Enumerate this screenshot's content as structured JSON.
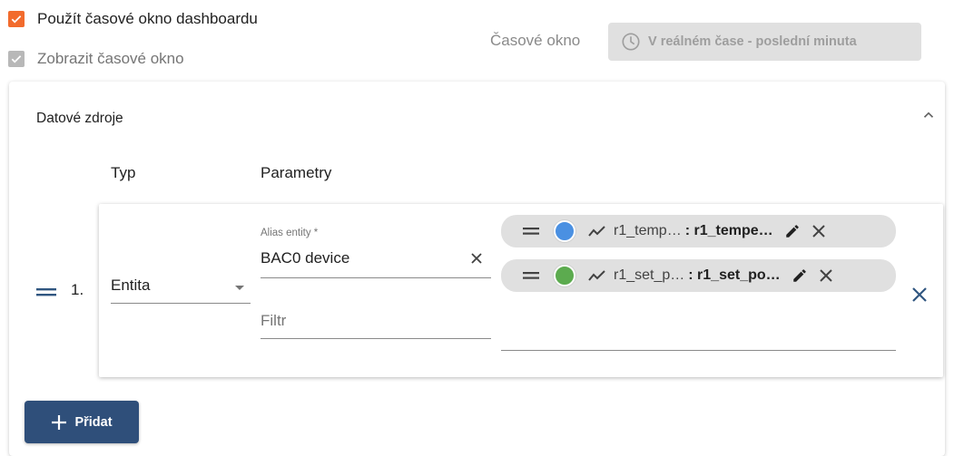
{
  "header": {
    "use_dashboard_timewindow": {
      "label": "Použít časové okno dashboardu",
      "checked": true
    },
    "display_timewindow": {
      "label": "Zobrazit časové okno",
      "checked": true
    },
    "timewindow_label": "Časové okno",
    "timewindow_value": "V reálném čase - poslední minuta",
    "icons": {
      "timewindow": "clock-icon"
    }
  },
  "datasources": {
    "title": "Datové zdroje",
    "columns": {
      "type": "Typ",
      "params": "Parametry"
    },
    "rows": [
      {
        "index": "1.",
        "type": "Entita",
        "alias_label": "Alias entity *",
        "alias_value": "BAC0 device",
        "filter_placeholder": "Filtr",
        "keys": [
          {
            "name": "r1_temp…",
            "label": ": r1_tempe…",
            "color": "#4a90e2"
          },
          {
            "name": "r1_set_p…",
            "label": ": r1_set_po…",
            "color": "#5cab4f"
          }
        ]
      }
    ],
    "add_label": "Přidat"
  },
  "colors": {
    "accent": "#f26b2d",
    "primary": "#2f4f7a",
    "remove": "#305680"
  }
}
